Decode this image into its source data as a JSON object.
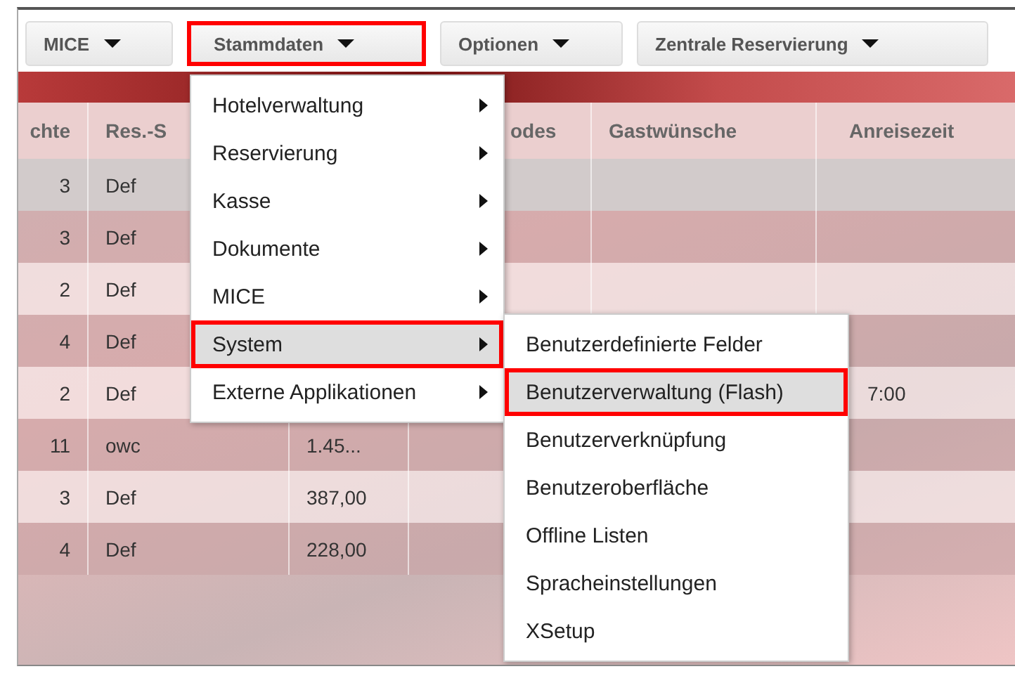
{
  "toolbar": [
    {
      "label": "MICE",
      "outlined": false
    },
    {
      "label": "Stammdaten",
      "outlined": true
    },
    {
      "label": "Optionen",
      "outlined": false
    },
    {
      "label": "Zentrale Reservierung",
      "outlined": false
    }
  ],
  "table": {
    "columns": [
      "chte",
      "Res.-S",
      "",
      "odes",
      "Gastwünsche",
      "Anreisezeit"
    ],
    "rows": [
      [
        "3",
        "Def",
        "",
        "",
        "",
        ""
      ],
      [
        "3",
        "Def",
        "",
        "",
        "",
        ""
      ],
      [
        "2",
        "Def",
        "",
        "",
        "",
        ""
      ],
      [
        "4",
        "Def",
        "",
        "",
        "",
        ""
      ],
      [
        "2",
        "Def",
        "",
        "",
        "",
        "7:00"
      ],
      [
        "11",
        "owc",
        "1.45...",
        "",
        "",
        ""
      ],
      [
        "3",
        "Def",
        "387,00",
        "",
        "",
        ""
      ],
      [
        "4",
        "Def",
        "228,00",
        "",
        "",
        ""
      ]
    ]
  },
  "menu": {
    "items": [
      {
        "label": "Hotelverwaltung",
        "hovered": false,
        "outlined": false
      },
      {
        "label": "Reservierung",
        "hovered": false,
        "outlined": false
      },
      {
        "label": "Kasse",
        "hovered": false,
        "outlined": false
      },
      {
        "label": "Dokumente",
        "hovered": false,
        "outlined": false
      },
      {
        "label": "MICE",
        "hovered": false,
        "outlined": false
      },
      {
        "label": "System",
        "hovered": true,
        "outlined": true
      },
      {
        "label": "Externe Applikationen",
        "hovered": false,
        "outlined": false
      }
    ]
  },
  "submenu": {
    "items": [
      {
        "label": "Benutzerdefinierte Felder",
        "hovered": false,
        "outlined": false
      },
      {
        "label": "Benutzerverwaltung (Flash)",
        "hovered": true,
        "outlined": true
      },
      {
        "label": "Benutzerverknüpfung",
        "hovered": false,
        "outlined": false
      },
      {
        "label": "Benutzeroberfläche",
        "hovered": false,
        "outlined": false
      },
      {
        "label": "Offline Listen",
        "hovered": false,
        "outlined": false
      },
      {
        "label": "Spracheinstellungen",
        "hovered": false,
        "outlined": false
      },
      {
        "label": "XSetup",
        "hovered": false,
        "outlined": false
      }
    ]
  }
}
